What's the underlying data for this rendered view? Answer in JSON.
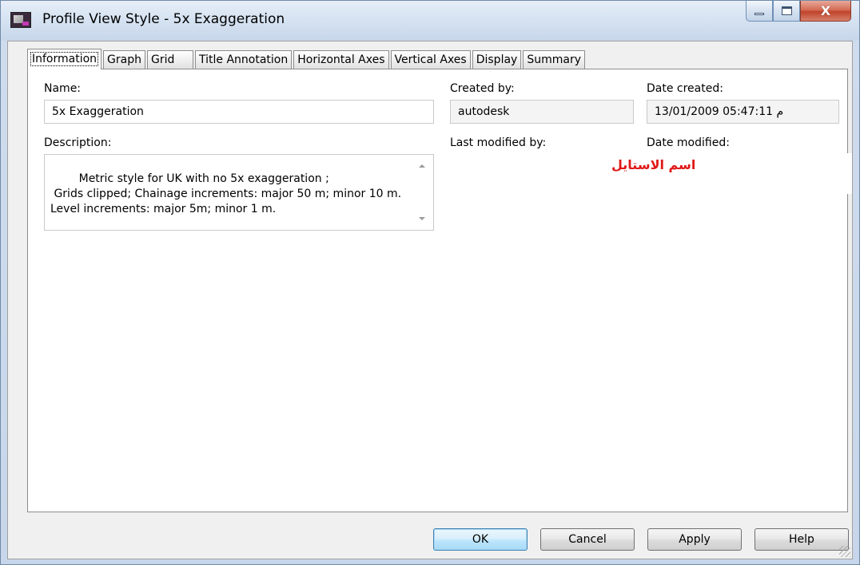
{
  "window": {
    "title": "Profile View Style - 5x Exaggeration",
    "close_glyph": "X"
  },
  "tabs": [
    {
      "label": "Information"
    },
    {
      "label": "Graph"
    },
    {
      "label": "Grid"
    },
    {
      "label": "Title Annotation"
    },
    {
      "label": "Horizontal Axes"
    },
    {
      "label": "Vertical Axes"
    },
    {
      "label": "Display"
    },
    {
      "label": "Summary"
    }
  ],
  "info": {
    "name_label": "Name:",
    "name_value": "5x Exaggeration",
    "created_by_label": "Created by:",
    "created_by_value": "autodesk",
    "date_created_label": "Date created:",
    "date_created_value": "13/01/2009 05:47:11 م",
    "description_label": "Description:",
    "description_value": "Metric style for UK with no 5x exaggeration ;\n Grids clipped; Chainage increments: major 50 m; minor 10 m. Level increments: major 5m; minor 1 m.",
    "last_modified_by_label": "Last modified by:",
    "date_modified_label": "Date modified:",
    "annotation_arabic": "اسم الاستايل"
  },
  "buttons": {
    "ok": "OK",
    "cancel": "Cancel",
    "apply": "Apply",
    "help": "Help"
  },
  "colors": {
    "annotation": "#e01818",
    "close_button": "#c1432a"
  }
}
